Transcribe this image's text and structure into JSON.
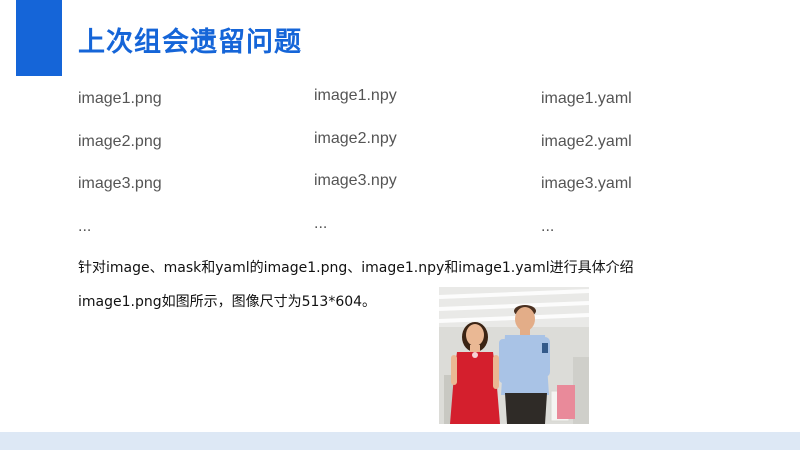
{
  "title": "上次组会遗留问题",
  "files": {
    "png": [
      "image1.png",
      "image2.png",
      "image3.png",
      "..."
    ],
    "npy": [
      "image1.npy",
      "image2.npy",
      "image3.npy",
      "..."
    ],
    "yaml": [
      "image1.yaml",
      "image2.yaml",
      "image3.yaml",
      "..."
    ]
  },
  "description": {
    "line1": "针对image、mask和yaml的image1.png、image1.npy和image1.yaml进行具体介绍",
    "line2": "image1.png如图所示，图像尺寸为513*604。"
  },
  "colors": {
    "accent": "#1565d8",
    "footer": "#dde8f5"
  }
}
